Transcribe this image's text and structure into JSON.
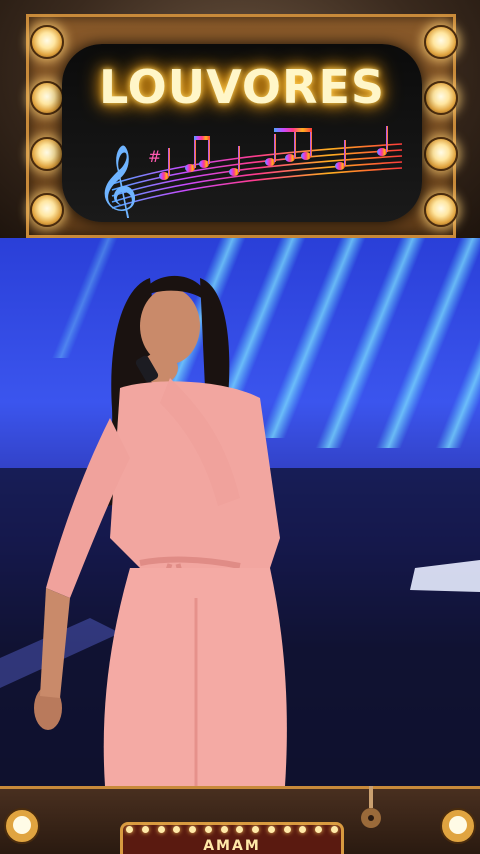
{
  "banner": {
    "title": "LOUVORES",
    "decoration_icon": "music-staff-icon",
    "bulb_icon": "stage-bulb-icon"
  },
  "video": {
    "description_icon": "performer-image"
  },
  "bottom_banner": {
    "marquee_text": "AMAM",
    "guitar_icon": "guitar-icon"
  },
  "colors": {
    "title_glow": "#ffb020",
    "frame_gold": "#c88a3a",
    "stage_blue": "#3b55ee",
    "outfit_pink": "#f2a6a0"
  }
}
